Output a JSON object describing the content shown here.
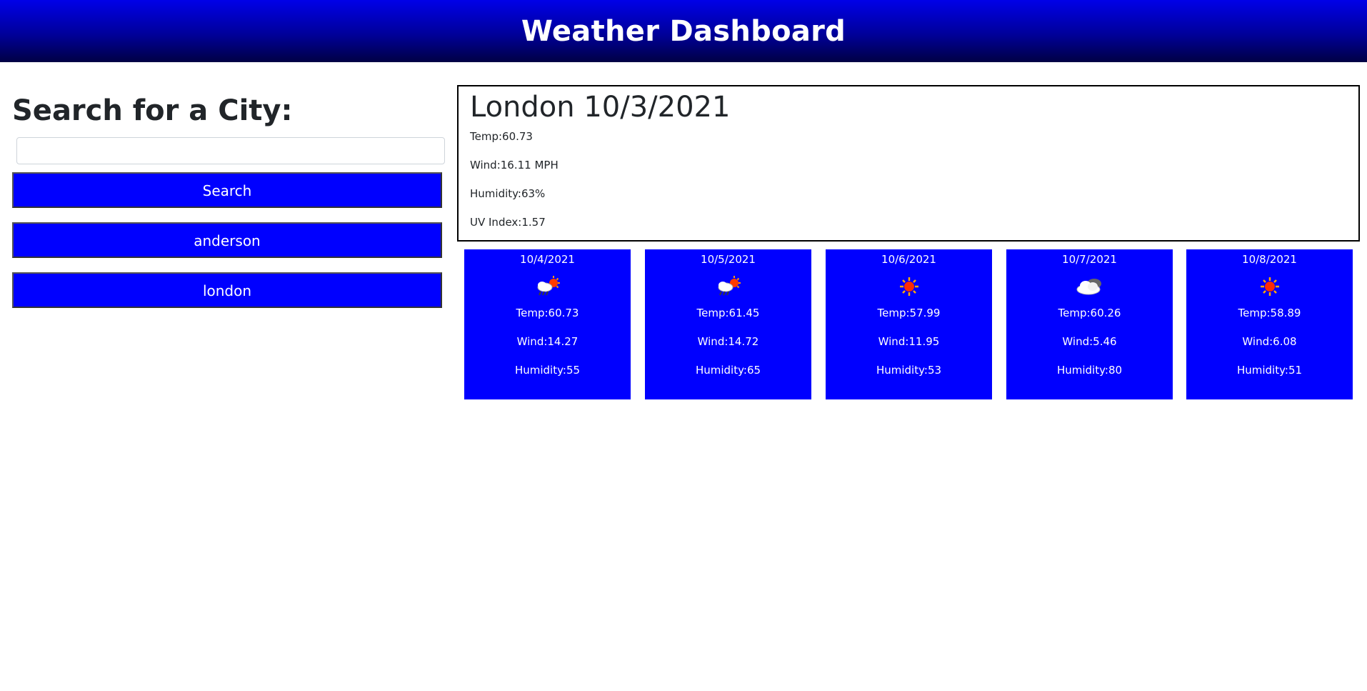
{
  "header": {
    "title": "Weather Dashboard"
  },
  "search": {
    "heading": "Search for a City:",
    "input_value": "",
    "placeholder": "",
    "button_label": "Search"
  },
  "history": [
    {
      "label": "anderson"
    },
    {
      "label": "london"
    }
  ],
  "current": {
    "title": "London 10/3/2021",
    "temp": "Temp:60.73",
    "wind": "Wind:16.11 MPH",
    "humidity": "Humidity:63%",
    "uv": "UV Index:1.57"
  },
  "forecast": [
    {
      "date": "10/4/2021",
      "icon": "rain-sun-icon",
      "temp": "Temp:60.73",
      "wind": "Wind:14.27",
      "humidity": "Humidity:55"
    },
    {
      "date": "10/5/2021",
      "icon": "rain-sun-icon",
      "temp": "Temp:61.45",
      "wind": "Wind:14.72",
      "humidity": "Humidity:65"
    },
    {
      "date": "10/6/2021",
      "icon": "sun-icon",
      "temp": "Temp:57.99",
      "wind": "Wind:11.95",
      "humidity": "Humidity:53"
    },
    {
      "date": "10/7/2021",
      "icon": "cloud-icon",
      "temp": "Temp:60.26",
      "wind": "Wind:5.46",
      "humidity": "Humidity:80"
    },
    {
      "date": "10/8/2021",
      "icon": "sun-icon",
      "temp": "Temp:58.89",
      "wind": "Wind:6.08",
      "humidity": "Humidity:51"
    }
  ],
  "colors": {
    "accent_blue": "#0000ff",
    "header_top": "#0000e8",
    "header_bottom": "#000044"
  }
}
